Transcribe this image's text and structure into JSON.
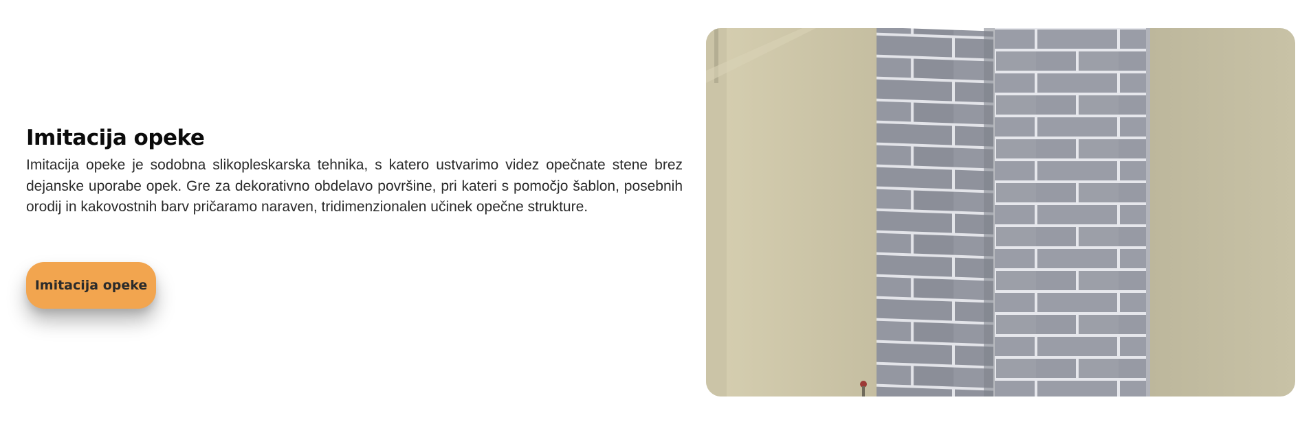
{
  "section": {
    "title": "Imitacija opeke",
    "description": "Imitacija opeke je sodobna slikopleskarska tehnika, s katero ustvarimo videz opečnate stene brez dejanske uporabe opek. Gre za dekorativno obdelavo površine, pri kateri s pomočjo šablon, posebnih orodij in kakovostnih barv pričaramo naraven, tridimenzionalen učinek opečne strukture.",
    "button_label": "Imitacija opeke"
  },
  "colors": {
    "accent": "#f2a54f",
    "wall": "#c9c2a4",
    "brick": "#8f929c",
    "mortar": "#e4e5ea"
  }
}
